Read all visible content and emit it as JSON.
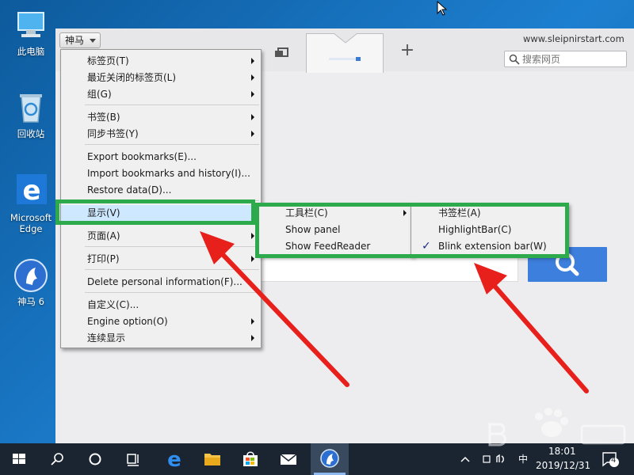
{
  "desktop": {
    "icons": [
      {
        "label": "此电脑",
        "icon": "computer-icon"
      },
      {
        "label": "回收站",
        "icon": "recycle-bin-icon"
      },
      {
        "label": "Microsoft Edge",
        "icon": "edge-icon"
      },
      {
        "label": "神马 6",
        "icon": "sleipnir-icon"
      }
    ]
  },
  "browser": {
    "brand_button": "神马",
    "site_url": "www.sleipnirstart.com",
    "search_placeholder": "搜索网页"
  },
  "main_menu": [
    {
      "label": "标签页(T)",
      "has_submenu": true
    },
    {
      "label": "最近关闭的标签页(L)",
      "has_submenu": true
    },
    {
      "label": "组(G)",
      "has_submenu": true
    },
    {
      "label": "书签(B)",
      "has_submenu": true
    },
    {
      "label": "同步书签(Y)",
      "has_submenu": true
    },
    {
      "label": "Export bookmarks(E)...",
      "has_submenu": false
    },
    {
      "label": "Import bookmarks and history(I)...",
      "has_submenu": false
    },
    {
      "label": "Restore data(D)...",
      "has_submenu": false
    },
    {
      "label": "显示(V)",
      "has_submenu": false,
      "highlighted": true
    },
    {
      "label": "页面(A)",
      "has_submenu": true
    },
    {
      "label": "打印(P)",
      "has_submenu": true
    },
    {
      "label": "Delete personal information(F)...",
      "has_submenu": false
    },
    {
      "label": "自定义(C)...",
      "has_submenu": false
    },
    {
      "label": "Engine option(O)",
      "has_submenu": true
    },
    {
      "label": "连续显示",
      "has_submenu": true
    }
  ],
  "display_submenu": [
    {
      "label": "工具栏(C)",
      "has_submenu": true
    },
    {
      "label": "Show panel",
      "has_submenu": false
    },
    {
      "label": "Show FeedReader",
      "has_submenu": false
    }
  ],
  "toolbar_submenu": [
    {
      "label": "书签栏(A)",
      "checked": false
    },
    {
      "label": "HighlightBar(C)",
      "checked": false
    },
    {
      "label": "Blink extension bar(W)",
      "checked": true
    }
  ],
  "taskbar": {
    "tray_text": "中",
    "time": "18:01",
    "date": "2019/12/31",
    "notification_count": "4"
  },
  "colors": {
    "highlight_box": "#2daa4b",
    "arrow": "#e8201c",
    "accent": "#3d7fdc"
  }
}
